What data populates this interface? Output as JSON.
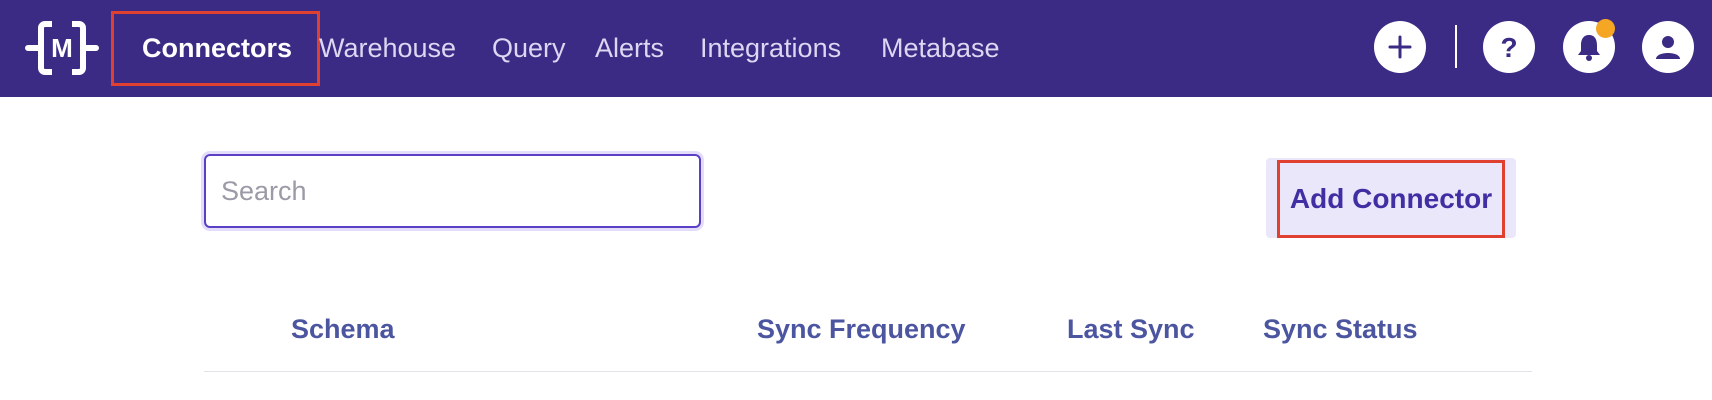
{
  "nav": {
    "logo_icon": "metaplane-logo-icon",
    "items": [
      {
        "label": "Connectors",
        "active": true
      },
      {
        "label": "Warehouse",
        "active": false
      },
      {
        "label": "Query",
        "active": false
      },
      {
        "label": "Alerts",
        "active": false
      },
      {
        "label": "Integrations",
        "active": false
      },
      {
        "label": "Metabase",
        "active": false
      }
    ],
    "actions": [
      {
        "icon": "plus-icon"
      },
      {
        "icon": "help-icon"
      },
      {
        "icon": "bell-icon",
        "has_notification": true
      },
      {
        "icon": "user-icon"
      }
    ]
  },
  "search": {
    "placeholder": "Search",
    "value": ""
  },
  "add_button": {
    "label": "Add Connector"
  },
  "table": {
    "columns": [
      "Schema",
      "Sync Frequency",
      "Last Sync",
      "Sync Status"
    ]
  },
  "colors": {
    "nav_bg": "#3b2b84",
    "accent": "#3f2fa3",
    "header_text": "#4c55a0",
    "highlight": "#e0402f",
    "notification": "#f5a623"
  }
}
